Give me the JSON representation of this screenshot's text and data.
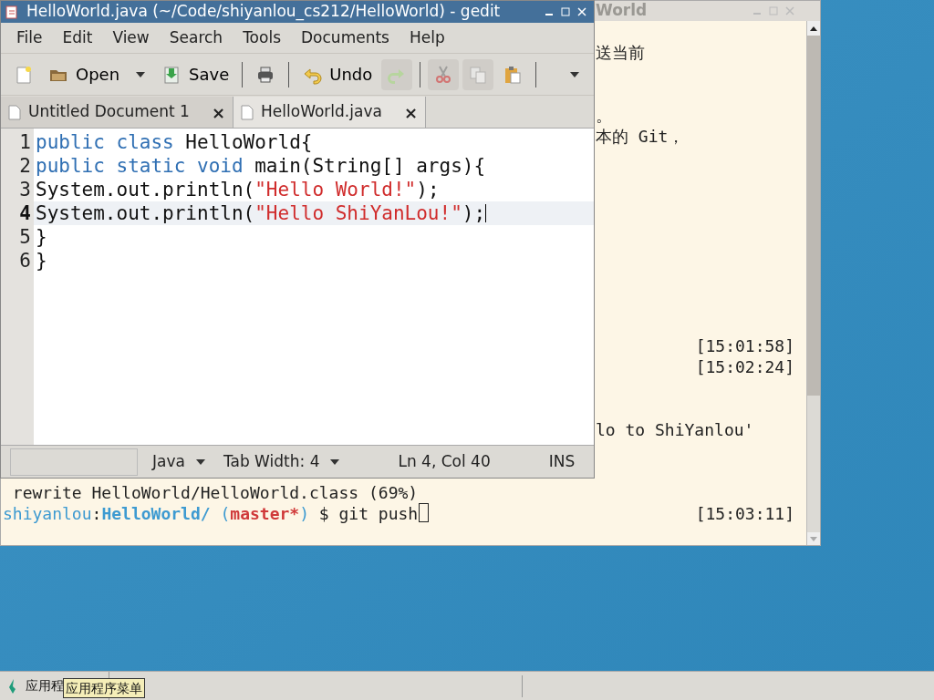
{
  "terminal": {
    "title": "World",
    "lines": [
      {
        "text": "送当前"
      },
      {
        "text": "。"
      },
      {
        "text": "本的 Git，"
      },
      {
        "time": "[15:01:58]"
      },
      {
        "time": "[15:02:24]"
      },
      {
        "text": "lo to ShiYanlou'"
      },
      {
        "text": " rewrite HelloWorld/HelloWorld.class (69%)"
      },
      {
        "prompt": [
          {
            "text": "shiyanlou",
            "color": "#3d9ad1"
          },
          {
            "text": ":",
            "color": "#222222"
          },
          {
            "text": "HelloWorld/",
            "color": "#3d9ad1"
          },
          {
            "text": " (",
            "color": "#3d9ad1"
          },
          {
            "text": "master*",
            "color": "#d03a3a"
          },
          {
            "text": ")",
            "color": "#3d9ad1"
          },
          {
            "text": " $ git push",
            "color": "#222222"
          }
        ],
        "time": "[15:03:11]"
      }
    ]
  },
  "gedit": {
    "title": "HelloWorld.java (~/Code/shiyanlou_cs212/HelloWorld) - gedit",
    "menu": [
      "File",
      "Edit",
      "View",
      "Search",
      "Tools",
      "Documents",
      "Help"
    ],
    "toolbar": [
      {
        "kind": "button",
        "disabled": false
      },
      {
        "kind": "button",
        "label": "Open",
        "disabled": false
      },
      {
        "kind": "dropdown"
      },
      {
        "kind": "button",
        "label": "Save",
        "disabled": false
      },
      {
        "kind": "separator"
      },
      {
        "kind": "button",
        "disabled": false
      },
      {
        "kind": "separator"
      },
      {
        "kind": "button",
        "label": "Undo",
        "disabled": false
      },
      {
        "kind": "button",
        "disabled": true
      },
      {
        "kind": "separator"
      },
      {
        "kind": "button",
        "disabled": true
      },
      {
        "kind": "button",
        "disabled": true
      },
      {
        "kind": "button",
        "disabled": false
      },
      {
        "kind": "separator"
      },
      {
        "kind": "overflow"
      }
    ],
    "tabs": [
      {
        "label": "Untitled Document 1",
        "selected": false,
        "close": "×"
      },
      {
        "label": "HelloWorld.java",
        "selected": true,
        "close": "×"
      }
    ],
    "code": [
      {
        "number": "1",
        "current": false,
        "tokens": [
          {
            "text": "public class",
            "kind": "keyword"
          },
          {
            "text": " HelloWorld{",
            "kind": "plain"
          }
        ]
      },
      {
        "number": "2",
        "current": false,
        "tokens": [
          {
            "text": "public static void",
            "kind": "keyword"
          },
          {
            "text": " main(String[] args){",
            "kind": "plain"
          }
        ]
      },
      {
        "number": "3",
        "current": false,
        "tokens": [
          {
            "text": "System.out.println(",
            "kind": "plain"
          },
          {
            "text": "\"Hello World!\"",
            "kind": "string"
          },
          {
            "text": ");",
            "kind": "plain"
          }
        ]
      },
      {
        "number": "4",
        "current": true,
        "tokens": [
          {
            "text": "System.out.println(",
            "kind": "plain"
          },
          {
            "text": "\"Hello ShiYanLou!\"",
            "kind": "string"
          },
          {
            "text": ");",
            "kind": "plain"
          }
        ]
      },
      {
        "number": "5",
        "current": false,
        "tokens": [
          {
            "text": "}",
            "kind": "plain"
          }
        ]
      },
      {
        "number": "6",
        "current": false,
        "tokens": [
          {
            "text": "}",
            "kind": "plain"
          }
        ]
      }
    ],
    "status": {
      "language": "Java",
      "tab_width": "Tab Width: 4",
      "position": "Ln 4, Col 40",
      "mode": "INS"
    }
  },
  "taskbar": {
    "menu_button": "应用程",
    "tooltip": "应用程序菜单"
  }
}
